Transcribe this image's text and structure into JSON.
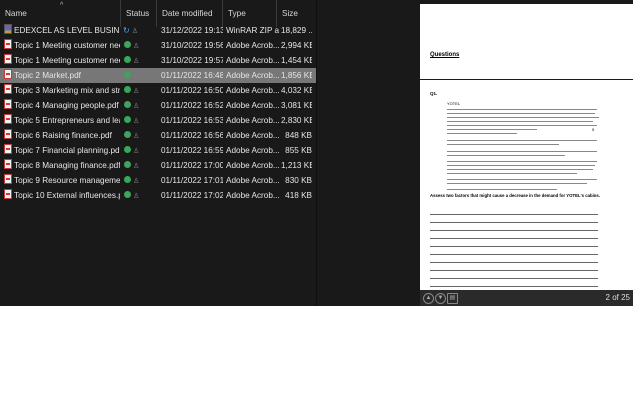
{
  "header": {
    "columns": [
      {
        "label": "Name"
      },
      {
        "label": "Status"
      },
      {
        "label": "Date modified"
      },
      {
        "label": "Type"
      },
      {
        "label": "Size"
      }
    ]
  },
  "files": [
    {
      "name": "EDEXCEL AS LEVEL BUSINESS ...",
      "icon": "zip-archive-icon",
      "status": "sync",
      "date": "31/12/2022 19:13",
      "type": "WinRAR ZIP a...",
      "size": "18,829 ...",
      "selected": false
    },
    {
      "name": "Topic 1 Meeting customer nee...",
      "icon": "pdf-file-icon",
      "status": "ok",
      "date": "31/10/2022 19:56",
      "type": "Adobe Acrob...",
      "size": "2,994 KB",
      "selected": false
    },
    {
      "name": "Topic 1 Meeting customer nee...",
      "icon": "pdf-file-icon",
      "status": "ok",
      "date": "31/10/2022 19:57",
      "type": "Adobe Acrob...",
      "size": "1,454 KB",
      "selected": false
    },
    {
      "name": "Topic 2 Market.pdf",
      "icon": "pdf-file-icon",
      "status": "ok",
      "date": "01/11/2022 16:48",
      "type": "Adobe Acrob...",
      "size": "1,856 KB",
      "selected": true
    },
    {
      "name": "Topic 3 Marketing mix and stra...",
      "icon": "pdf-file-icon",
      "status": "ok",
      "date": "01/11/2022 16:50",
      "type": "Adobe Acrob...",
      "size": "4,032 KB",
      "selected": false
    },
    {
      "name": "Topic 4 Managing people.pdf",
      "icon": "pdf-file-icon",
      "status": "ok",
      "date": "01/11/2022 16:52",
      "type": "Adobe Acrob...",
      "size": "3,081 KB",
      "selected": false
    },
    {
      "name": "Topic 5 Entrepreneurs and lead...",
      "icon": "pdf-file-icon",
      "status": "ok",
      "date": "01/11/2022 16:53",
      "type": "Adobe Acrob...",
      "size": "2,830 KB",
      "selected": false
    },
    {
      "name": "Topic 6 Raising finance.pdf",
      "icon": "pdf-file-icon",
      "status": "ok",
      "date": "01/11/2022 16:56",
      "type": "Adobe Acrob...",
      "size": "848 KB",
      "selected": false
    },
    {
      "name": "Topic 7 Financial planning.pdf",
      "icon": "pdf-file-icon",
      "status": "ok",
      "date": "01/11/2022 16:59",
      "type": "Adobe Acrob...",
      "size": "855 KB",
      "selected": false
    },
    {
      "name": "Topic 8 Managing finance.pdf",
      "icon": "pdf-file-icon",
      "status": "ok",
      "date": "01/11/2022 17:00",
      "type": "Adobe Acrob...",
      "size": "1,213 KB",
      "selected": false
    },
    {
      "name": "Topic 9  Resource managemen...",
      "icon": "pdf-file-icon",
      "status": "ok",
      "date": "01/11/2022 17:01",
      "type": "Adobe Acrob...",
      "size": "830 KB",
      "selected": false
    },
    {
      "name": "Topic 10 External influences.pdf",
      "icon": "pdf-file-icon",
      "status": "ok",
      "date": "01/11/2022 17:02",
      "type": "Adobe Acrob...",
      "size": "418 KB",
      "selected": false
    }
  ],
  "preview": {
    "heading": "Questions",
    "question_number": "Q1.",
    "passage_title": "YOTEL",
    "prompt": "Assess two factors that might cause a decrease in the demand for YOTEL's cabins.",
    "page_info": "2 of 25"
  },
  "colors": {
    "background": "#191919",
    "selected_row": "#777777",
    "status_ok": "#3ba55c",
    "status_sync": "#4aa3ff"
  }
}
